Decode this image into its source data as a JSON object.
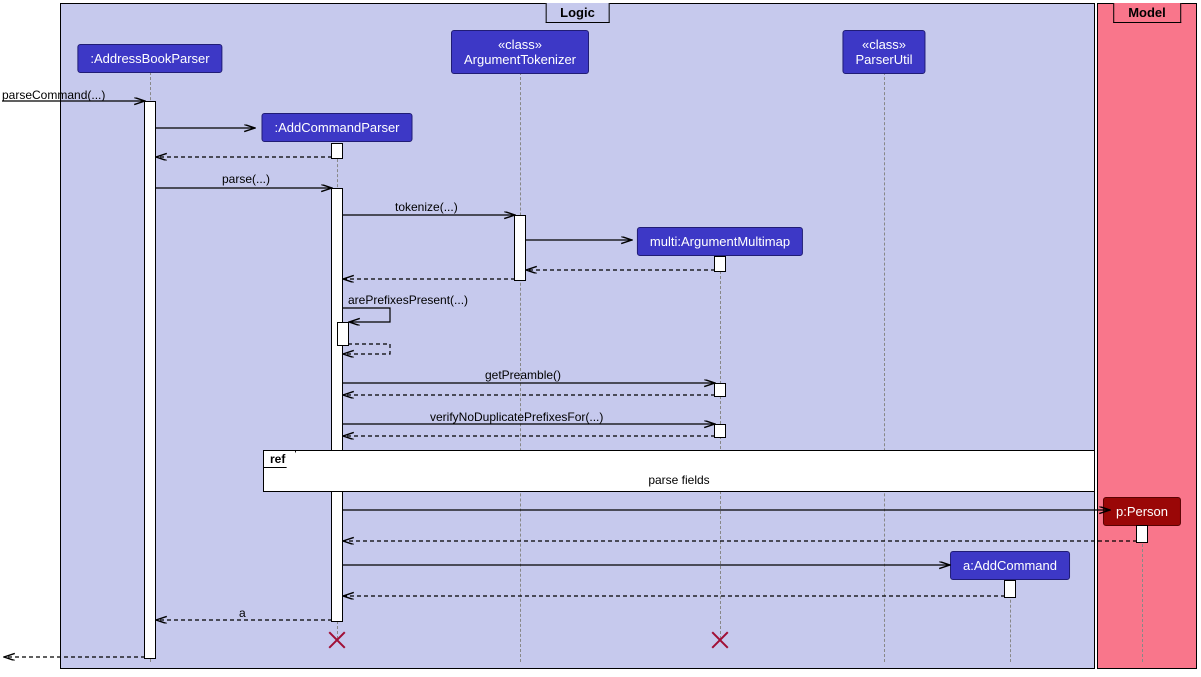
{
  "packages": {
    "logic": "Logic",
    "model": "Model"
  },
  "participants": {
    "abp": {
      "label": ":AddressBookParser"
    },
    "acp": {
      "label": ":AddCommandParser"
    },
    "at": {
      "stereo": "«class»",
      "label": "ArgumentTokenizer"
    },
    "pu": {
      "stereo": "«class»",
      "label": "ParserUtil"
    },
    "amm": {
      "label": "multi:ArgumentMultimap"
    },
    "ac": {
      "label": "a:AddCommand"
    },
    "per": {
      "label": "p:Person"
    }
  },
  "messages": {
    "parseCommand": "parseCommand(...)",
    "parse": "parse(...)",
    "tokenize": "tokenize(...)",
    "arePrefixesPresent": "arePrefixesPresent(...)",
    "getPreamble": "getPreamble()",
    "verifyNoDup": "verifyNoDuplicatePrefixesFor(...)",
    "ret_a": "a"
  },
  "ref": {
    "tag": "ref",
    "title": "parse fields"
  },
  "chart_data": {
    "type": "uml_sequence",
    "packages": [
      {
        "name": "Logic",
        "participants": [
          ":AddressBookParser",
          ":AddCommandParser",
          "«class» ArgumentTokenizer",
          "«class» ParserUtil",
          "multi:ArgumentMultimap",
          "a:AddCommand"
        ]
      },
      {
        "name": "Model",
        "participants": [
          "p:Person"
        ]
      }
    ],
    "interactions": [
      {
        "from": "external",
        "to": ":AddressBookParser",
        "label": "parseCommand(...)",
        "type": "call"
      },
      {
        "from": ":AddressBookParser",
        "to": ":AddCommandParser",
        "type": "create"
      },
      {
        "from": ":AddCommandParser",
        "to": ":AddressBookParser",
        "type": "return"
      },
      {
        "from": ":AddressBookParser",
        "to": ":AddCommandParser",
        "label": "parse(...)",
        "type": "call"
      },
      {
        "from": ":AddCommandParser",
        "to": "ArgumentTokenizer",
        "label": "tokenize(...)",
        "type": "call"
      },
      {
        "from": "ArgumentTokenizer",
        "to": "multi:ArgumentMultimap",
        "type": "create"
      },
      {
        "from": "multi:ArgumentMultimap",
        "to": "ArgumentTokenizer",
        "type": "return"
      },
      {
        "from": "ArgumentTokenizer",
        "to": ":AddCommandParser",
        "type": "return"
      },
      {
        "from": ":AddCommandParser",
        "to": ":AddCommandParser",
        "label": "arePrefixesPresent(...)",
        "type": "selfcall"
      },
      {
        "from": ":AddCommandParser",
        "to": ":AddCommandParser",
        "type": "return"
      },
      {
        "from": ":AddCommandParser",
        "to": "multi:ArgumentMultimap",
        "label": "getPreamble()",
        "type": "call"
      },
      {
        "from": "multi:ArgumentMultimap",
        "to": ":AddCommandParser",
        "type": "return"
      },
      {
        "from": ":AddCommandParser",
        "to": "multi:ArgumentMultimap",
        "label": "verifyNoDuplicatePrefixesFor(...)",
        "type": "call"
      },
      {
        "from": "multi:ArgumentMultimap",
        "to": ":AddCommandParser",
        "type": "return"
      },
      {
        "type": "ref",
        "label": "parse fields",
        "over": [
          ":AddCommandParser",
          "multi:ArgumentMultimap",
          "ParserUtil"
        ]
      },
      {
        "from": ":AddCommandParser",
        "to": "p:Person",
        "type": "create"
      },
      {
        "from": "p:Person",
        "to": ":AddCommandParser",
        "type": "return"
      },
      {
        "from": ":AddCommandParser",
        "to": "a:AddCommand",
        "type": "create"
      },
      {
        "from": "a:AddCommand",
        "to": ":AddCommandParser",
        "type": "return"
      },
      {
        "from": ":AddCommandParser",
        "to": ":AddressBookParser",
        "label": "a",
        "type": "return"
      },
      {
        "type": "destroy",
        "participant": ":AddCommandParser"
      },
      {
        "type": "destroy",
        "participant": "multi:ArgumentMultimap"
      },
      {
        "from": ":AddressBookParser",
        "to": "external",
        "type": "return"
      }
    ]
  }
}
